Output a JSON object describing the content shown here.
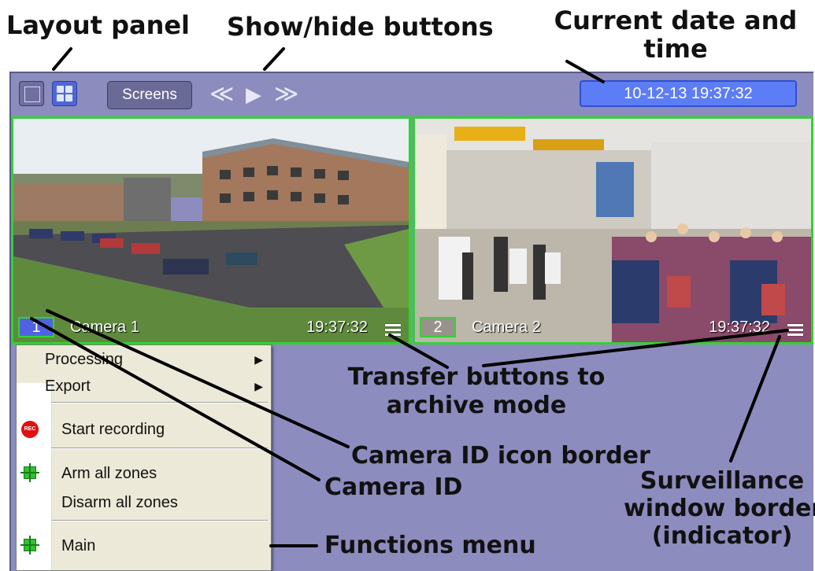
{
  "callouts": {
    "layout_panel": "Layout panel",
    "show_hide": "Show/hide buttons",
    "date_time_line1": "Current date and",
    "date_time_line2": "time",
    "transfer_line1": "Transfer buttons to",
    "transfer_line2": "archive mode",
    "camera_id_border": "Camera ID icon border",
    "camera_id": "Camera ID",
    "surveillance_line1": "Surveillance",
    "surveillance_line2": "window border",
    "surveillance_line3": "(indicator)",
    "functions_menu": "Functions menu"
  },
  "toolbar": {
    "screens_label": "Screens",
    "prev_symbol": "≪",
    "play_symbol": "▶",
    "next_symbol": "≫",
    "datetime": "10-12-13   19:37:32"
  },
  "cameras": [
    {
      "id": "1",
      "name": "Camera 1",
      "time": "19:37:32"
    },
    {
      "id": "2",
      "name": "Camera 2",
      "time": "19:37:32"
    }
  ],
  "menu": {
    "processing": "Processing",
    "export": "Export",
    "start_recording": "Start recording",
    "rec_badge": "REC",
    "arm_all": "Arm all zones",
    "disarm_all": "Disarm all zones",
    "main": "Main",
    "submenu_symbol": "▶"
  },
  "colors": {
    "app_bg": "#8c8cbf",
    "indicator_border": "#32d232",
    "datetime_bg": "#5c7df6",
    "menu_bg": "#ece9d8"
  }
}
